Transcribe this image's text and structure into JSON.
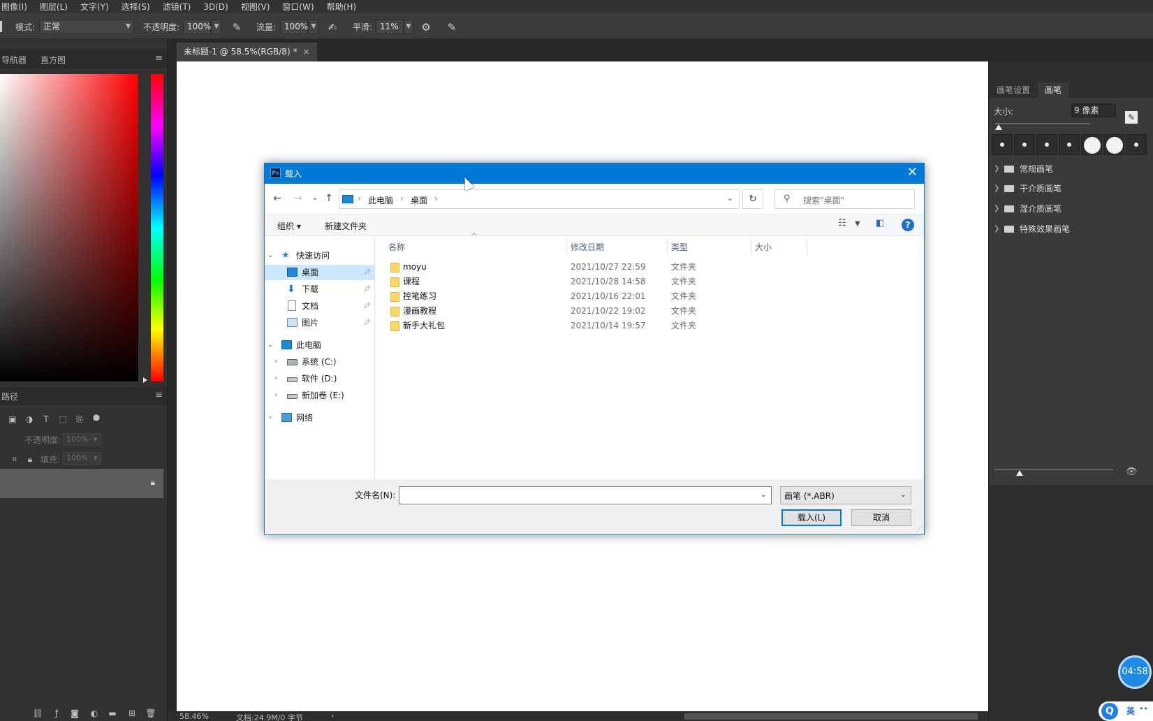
{
  "menu": [
    "图像(I)",
    "图层(L)",
    "文字(Y)",
    "选择(S)",
    "滤镜(T)",
    "3D(D)",
    "视图(V)",
    "窗口(W)",
    "帮助(H)"
  ],
  "options": {
    "mode_label": "模式:",
    "mode_value": "正常",
    "opacity_label": "不透明度:",
    "opacity_value": "100%",
    "flow_label": "流量:",
    "flow_value": "100%",
    "smooth_label": "平滑:",
    "smooth_value": "11%"
  },
  "left_panel": {
    "top_tabs": [
      "导航器",
      "直方图"
    ],
    "mid_tab": "路径",
    "opacity_label": "不透明度:",
    "opacity_value": "100%",
    "fill_label": "填充:",
    "fill_value": "100%"
  },
  "document": {
    "tab_title": "未标题-1 @ 58.5%(RGB/8) *",
    "tab_close": "×",
    "zoom": "58.46%",
    "doc_info": "文档:24.9M/0 字节"
  },
  "brush_panel": {
    "tabs": [
      "画笔设置",
      "画笔"
    ],
    "size_label": "大小:",
    "size_value": "9 像素",
    "folders": [
      "常规画笔",
      "干介质画笔",
      "湿介质画笔",
      "特殊效果画笔"
    ]
  },
  "dialog": {
    "title": "载入",
    "close": "✕",
    "breadcrumb": [
      "此电脑",
      "桌面"
    ],
    "search_placeholder": "搜索\"桌面\"",
    "organize": "组织 ▾",
    "new_folder": "新建文件夹",
    "help": "?",
    "tree": {
      "quick_access": "快速访问",
      "desktop": "桌面",
      "downloads": "下载",
      "documents": "文档",
      "pictures": "图片",
      "this_pc": "此电脑",
      "drive_c": "系统 (C:)",
      "drive_d": "软件 (D:)",
      "drive_e": "新加卷 (E:)",
      "network": "网络"
    },
    "columns": {
      "name": "名称",
      "date": "修改日期",
      "type": "类型",
      "size": "大小"
    },
    "files": [
      {
        "name": "moyu",
        "date": "2021/10/27 22:59",
        "type": "文件夹"
      },
      {
        "name": "课程",
        "date": "2021/10/28 14:58",
        "type": "文件夹"
      },
      {
        "name": "控笔练习",
        "date": "2021/10/16 22:01",
        "type": "文件夹"
      },
      {
        "name": "漫画教程",
        "date": "2021/10/22 19:02",
        "type": "文件夹"
      },
      {
        "name": "新手大礼包",
        "date": "2021/10/14 19:57",
        "type": "文件夹"
      }
    ],
    "filename_label": "文件名(N):",
    "filename_value": "",
    "filetype_value": "画笔 (*.ABR)",
    "load_button": "载入(L)",
    "cancel_button": "取消"
  },
  "overlay": {
    "timer": "04:58",
    "ime_lang": "英"
  }
}
